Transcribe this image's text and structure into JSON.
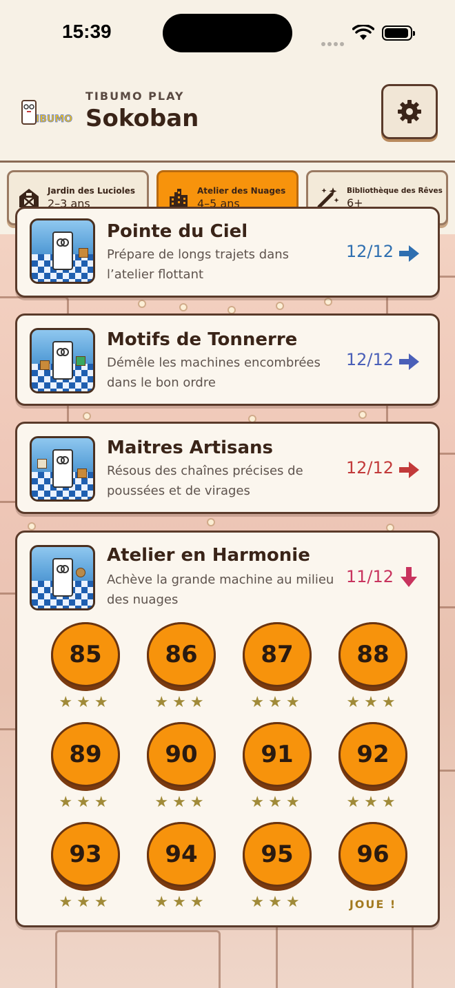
{
  "status_bar": {
    "time": "15:39"
  },
  "header": {
    "brand": "TIBUMO PLAY",
    "title": "Sokoban",
    "logo_text": "IBUMO"
  },
  "tabs": [
    {
      "name": "Jardin des Lucioles",
      "age": "2–3 ans",
      "icon": "barn-icon",
      "active": false
    },
    {
      "name": "Atelier des Nuages",
      "age": "4–5 ans",
      "icon": "city-icon",
      "active": true
    },
    {
      "name": "Bibliothèque des Rêves",
      "age": "6+",
      "icon": "magic-wand-icon",
      "active": false
    }
  ],
  "chapters": [
    {
      "title": "Pointe du Ciel",
      "desc": "Prépare de longs trajets dans l’atelier flottant",
      "progress": "12/12",
      "color": "#2f6fb0",
      "icon": "arrow-right-icon"
    },
    {
      "title": "Motifs de Tonnerre",
      "desc": "Démêle les machines encombrées dans le bon ordre",
      "progress": "12/12",
      "color": "#4a5fb8",
      "icon": "arrow-right-icon"
    },
    {
      "title": "Maitres Artisans",
      "desc": "Résous des chaînes précises de poussées et de virages",
      "progress": "12/12",
      "color": "#c23a3a",
      "icon": "arrow-right-icon"
    },
    {
      "title": "Atelier en Harmonie",
      "desc": "Achève la grande machine au milieu des nuages",
      "progress": "11/12",
      "color": "#c8335e",
      "icon": "arrow-down-icon"
    }
  ],
  "levels": [
    {
      "number": "85",
      "stars": "★★★"
    },
    {
      "number": "86",
      "stars": "★★★"
    },
    {
      "number": "87",
      "stars": "★★★"
    },
    {
      "number": "88",
      "stars": "★★★"
    },
    {
      "number": "89",
      "stars": "★★★"
    },
    {
      "number": "90",
      "stars": "★★★"
    },
    {
      "number": "91",
      "stars": "★★★"
    },
    {
      "number": "92",
      "stars": "★★★"
    },
    {
      "number": "93",
      "stars": "★★★"
    },
    {
      "number": "94",
      "stars": "★★★"
    },
    {
      "number": "95",
      "stars": "★★★"
    },
    {
      "number": "96",
      "played_label": "JOUE !"
    }
  ]
}
